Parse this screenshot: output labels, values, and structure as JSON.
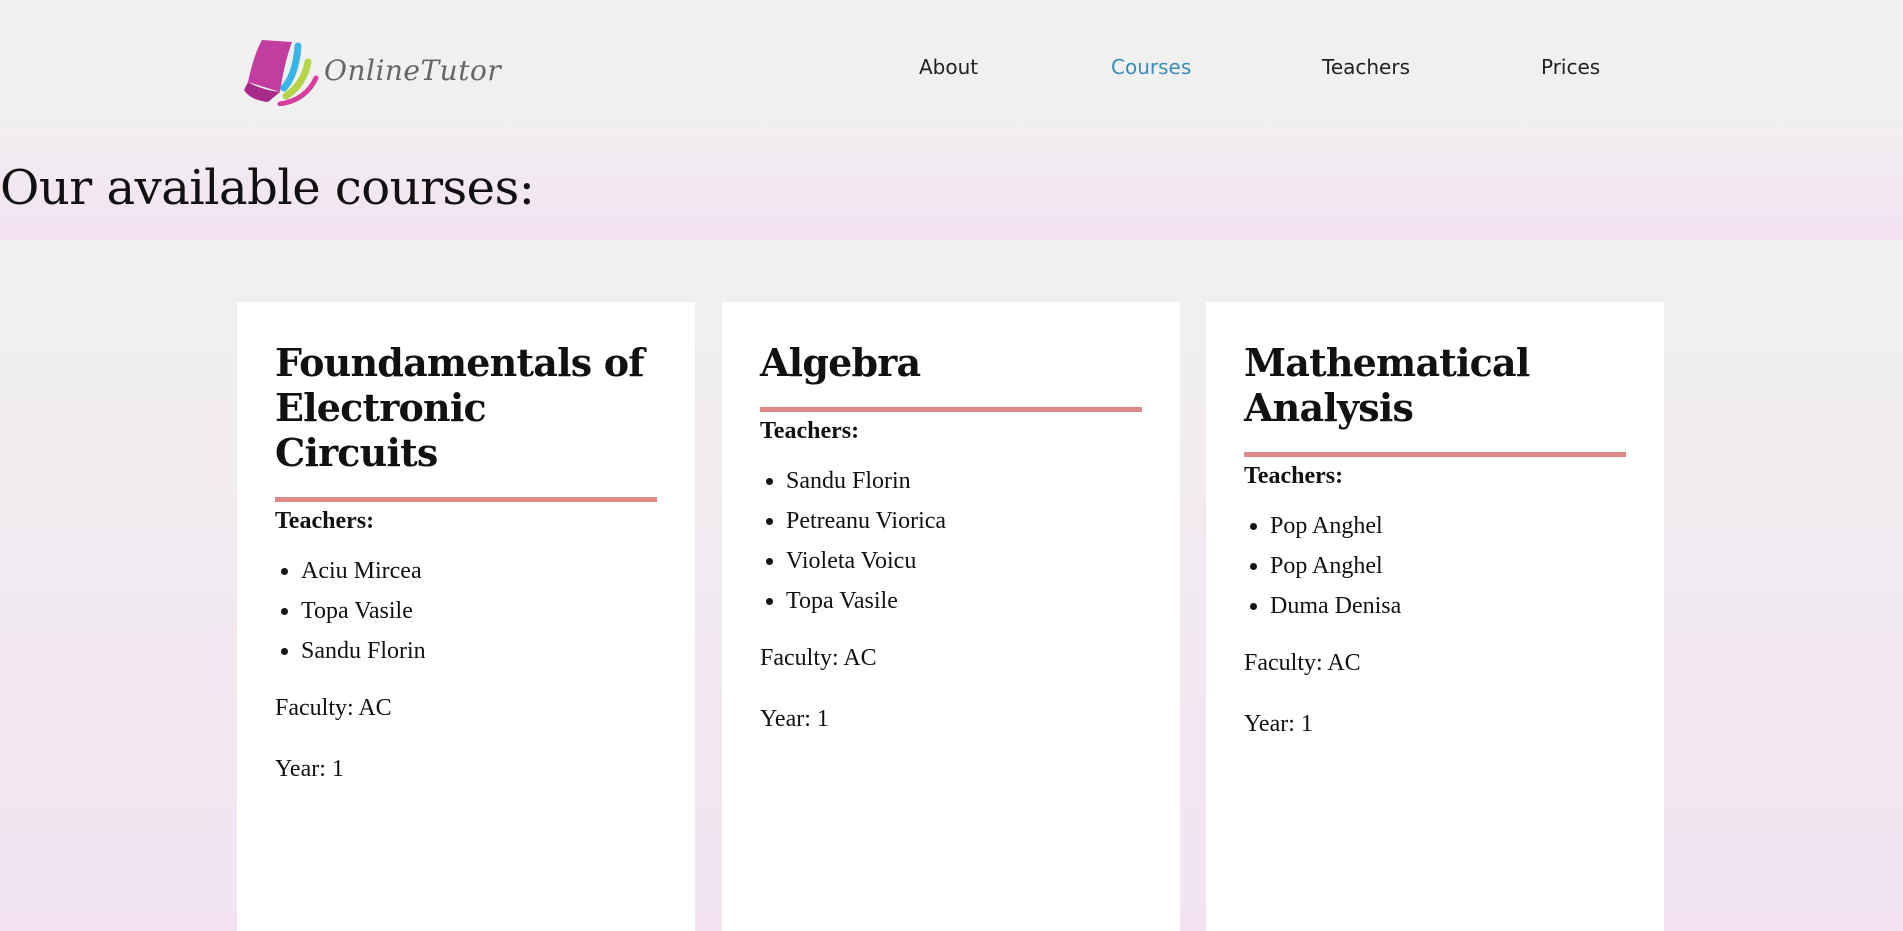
{
  "brand": {
    "name": "OnlineTutor",
    "logo_icon": "book-pages-icon"
  },
  "nav": {
    "items": [
      {
        "label": "About"
      },
      {
        "label": "Courses"
      },
      {
        "label": "Teachers"
      },
      {
        "label": "Prices"
      }
    ],
    "active_color": "#3c8db5"
  },
  "page": {
    "title": "Our available courses:"
  },
  "courses": [
    {
      "title": "Foundamentals of Electronic Circuits",
      "teachers_label": "Teachers:",
      "teachers": [
        "Aciu Mircea",
        "Topa Vasile",
        "Sandu Florin"
      ],
      "faculty": "Faculty: AC",
      "year": "Year: 1"
    },
    {
      "title": "Algebra",
      "teachers_label": "Teachers:",
      "teachers": [
        "Sandu Florin",
        "Petreanu Viorica",
        "Violeta Voicu",
        "Topa Vasile"
      ],
      "faculty": "Faculty: AC",
      "year": "Year: 1"
    },
    {
      "title": "Mathematical Analysis",
      "teachers_label": "Teachers:",
      "teachers": [
        "Pop Anghel",
        "Pop Anghel",
        "Duma Denisa"
      ],
      "faculty": "Faculty: AC",
      "year": "Year: 1"
    }
  ],
  "colors": {
    "title_underline": "#e08888",
    "card_background": "#ffffff"
  }
}
